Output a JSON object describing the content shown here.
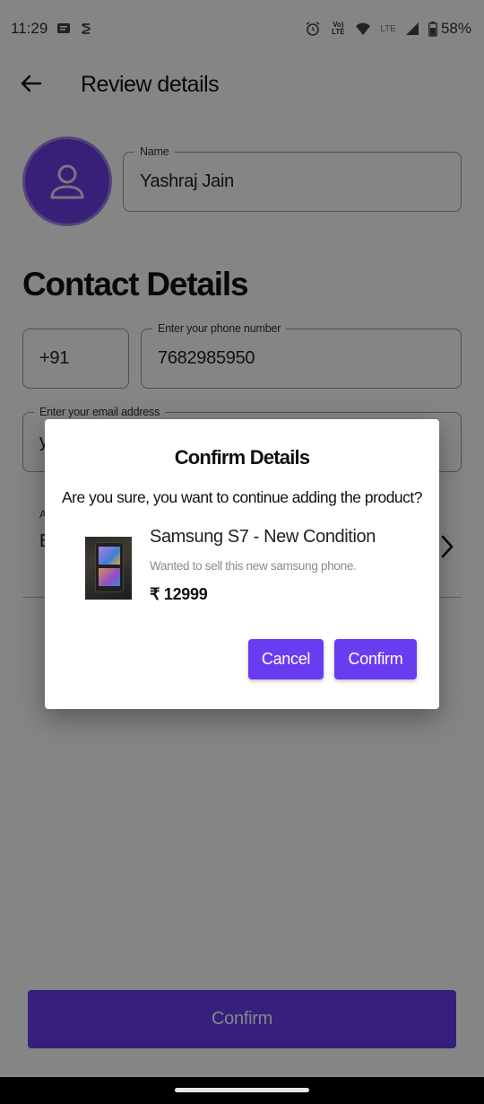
{
  "status_bar": {
    "time": "11:29",
    "volte_label": "Vo) LTE",
    "lte_label": "LTE",
    "battery": "58%"
  },
  "app_bar": {
    "title": "Review details"
  },
  "profile": {
    "name_label": "Name",
    "name_value": "Yashraj Jain"
  },
  "contact": {
    "section_title": "Contact Details",
    "country_code": "+91",
    "phone_label": "Enter your phone number",
    "phone_value": "7682985950",
    "email_label": "Enter your email address",
    "email_value_partial": "y",
    "address_label_partial": "A",
    "address_value_partial": "E"
  },
  "bottom_button": {
    "label": "Confirm"
  },
  "dialog": {
    "title": "Confirm Details",
    "message": "Are you sure, you want to continue adding the product?",
    "product": {
      "name": "Samsung S7 - New Condition",
      "description": "Wanted to sell this new samsung phone.",
      "price": "₹ 12999"
    },
    "cancel_label": "Cancel",
    "confirm_label": "Confirm"
  },
  "colors": {
    "primary": "#6a3cf0",
    "avatar_bg": "#6c3ee6",
    "scrim": "rgba(0,0,0,0.48)"
  }
}
